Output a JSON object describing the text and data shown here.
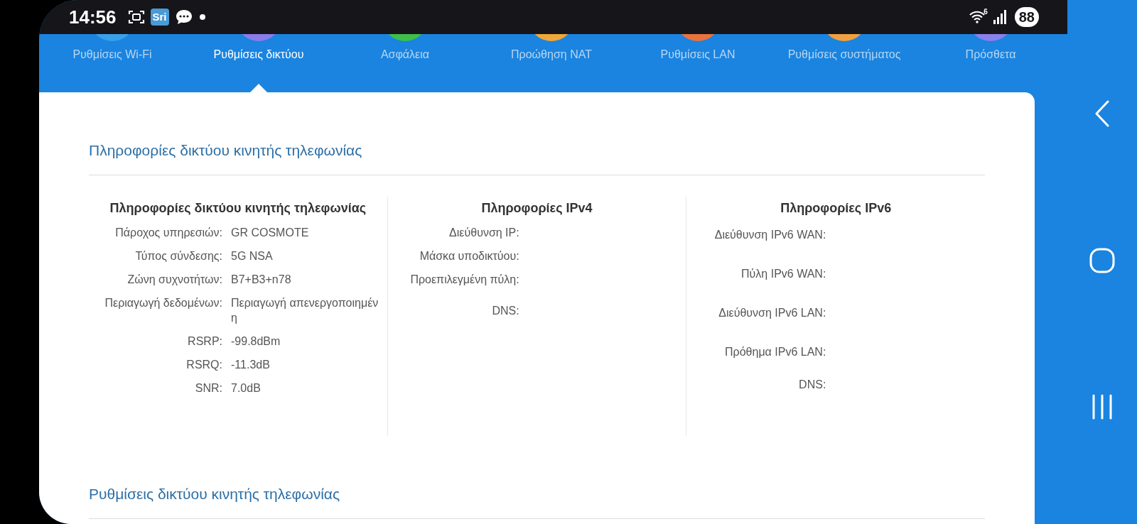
{
  "status_bar": {
    "time": "14:56",
    "app_badge": "Sri",
    "wifi_badge": "6",
    "battery": "88"
  },
  "nav_tabs": [
    {
      "label": "Ρυθμίσεις Wi-Fi",
      "color": "#3aa0ea",
      "selected": false
    },
    {
      "label": "Ρυθμίσεις δικτύου",
      "color": "#8a7cea",
      "selected": true
    },
    {
      "label": "Ασφάλεια",
      "color": "#3fbf4a",
      "selected": false
    },
    {
      "label": "Προώθηση NAT",
      "color": "#f0a838",
      "selected": false
    },
    {
      "label": "Ρυθμίσεις LAN",
      "color": "#e8733e",
      "selected": false
    },
    {
      "label": "Ρυθμίσεις συστήματος",
      "color": "#f0a040",
      "selected": false
    },
    {
      "label": "Πρόσθετα",
      "color": "#8a80ec",
      "selected": false
    }
  ],
  "sections": [
    {
      "title": "Πληροφορίες δικτύου κινητής τηλεφωνίας",
      "columns": [
        {
          "heading": "Πληροφορίες δικτύου κινητής τηλεφωνίας",
          "rows": [
            {
              "label": "Πάροχος υπηρεσιών:",
              "value": "GR COSMOTE"
            },
            {
              "label": "Τύπος σύνδεσης:",
              "value": "5G NSA"
            },
            {
              "label": "Ζώνη συχνοτήτων:",
              "value": "B7+B3+n78"
            },
            {
              "label": "Περιαγωγή δεδομένων:",
              "value": "Περιαγωγή απενεργοποιημένη"
            },
            {
              "label": "RSRP:",
              "value": "-99.8dBm"
            },
            {
              "label": "RSRQ:",
              "value": "-11.3dB"
            },
            {
              "label": "SNR:",
              "value": "7.0dB"
            }
          ]
        },
        {
          "heading": "Πληροφορίες IPv4",
          "rows": [
            {
              "label": "Διεύθυνση IP:"
            },
            {
              "label": "Μάσκα υποδικτύου:"
            },
            {
              "label": "Προεπιλεγμένη πύλη:"
            },
            {
              "label": "DNS:"
            }
          ]
        },
        {
          "heading": "Πληροφορίες IPv6",
          "rows": [
            {
              "label": "Διεύθυνση IPv6 WAN:"
            },
            {
              "label": "Πύλη IPv6 WAN:"
            },
            {
              "label": "Διεύθυνση IPv6 LAN:"
            },
            {
              "label": "Πρόθημα IPv6 LAN:"
            },
            {
              "label": "DNS:"
            }
          ]
        }
      ]
    },
    {
      "title": "Ρυθμίσεις δικτύου κινητής τηλεφωνίας"
    }
  ]
}
